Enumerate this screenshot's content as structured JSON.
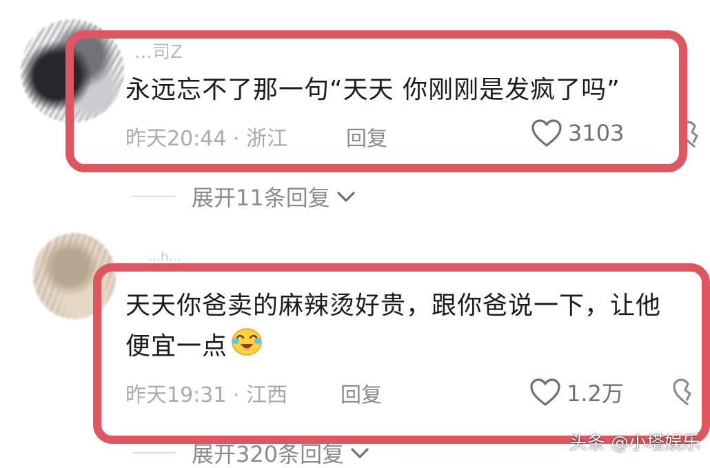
{
  "comments": [
    {
      "username": "…司Z",
      "text_lines": [
        "永远忘不了那一句“天天 你刚刚是发疯了吗”"
      ],
      "time_location": "昨天20:44 · 浙江",
      "reply_label": "回复",
      "like_count": "3103",
      "expand_label": "展开11条回复"
    },
    {
      "username": "…h…",
      "text_lines": [
        "天天你爸卖的麻辣烫好贵，跟你爸说一下，让他",
        "便宜一点"
      ],
      "emoji": "laughing-crying-emoji",
      "time_location": "昨天19:31 · 江西",
      "reply_label": "回复",
      "like_count": "1.2万",
      "expand_label": "展开320条回复"
    }
  ],
  "icons": {
    "like": "heart-outline-icon",
    "dislike": "broken-heart-icon",
    "expand": "chevron-down-icon"
  },
  "colors": {
    "highlight": "#e05660",
    "text": "#1b1b1f",
    "meta": "#a9a9ae"
  },
  "watermark": "头条 @小塔娱乐"
}
